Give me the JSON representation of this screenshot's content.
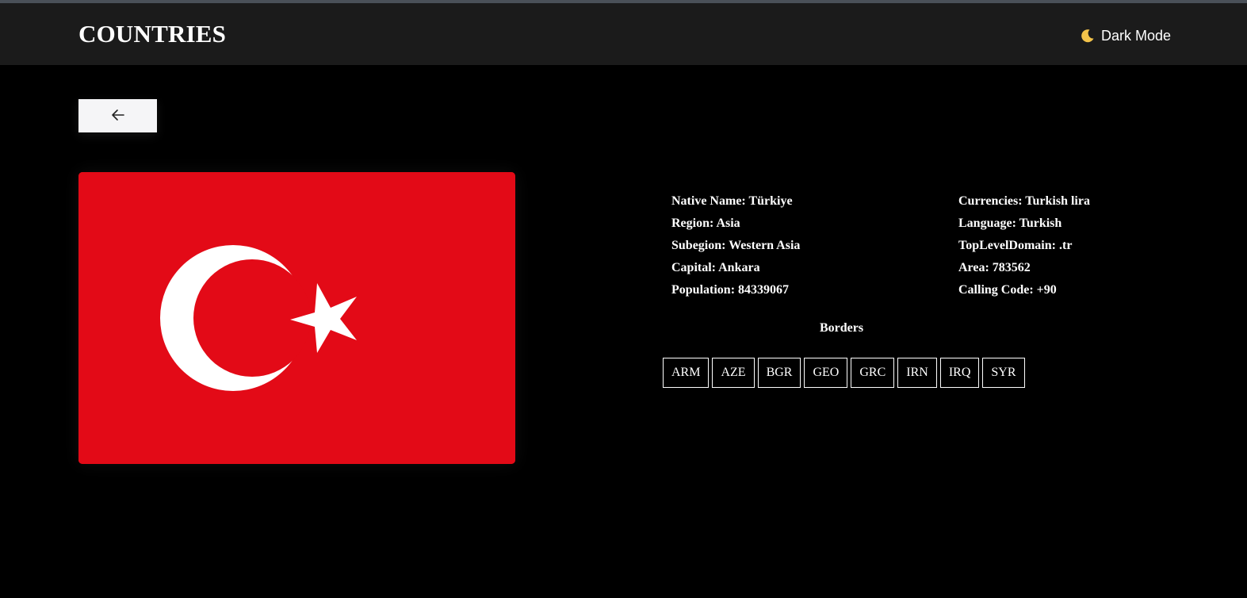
{
  "header": {
    "title": "COUNTRIES",
    "mode_label": "Dark Mode",
    "mode_icon": "moon-icon"
  },
  "back_button": {
    "icon": "arrow-left-icon"
  },
  "flag": {
    "country": "Türkiye",
    "background_color": "#e30a17",
    "emblem_color": "#ffffff"
  },
  "details": {
    "left": [
      {
        "label": "Native Name:",
        "value": "Türkiye"
      },
      {
        "label": "Region:",
        "value": "Asia"
      },
      {
        "label": "Subegion:",
        "value": "Western Asia"
      },
      {
        "label": "Capital:",
        "value": "Ankara"
      },
      {
        "label": "Population:",
        "value": "84339067"
      }
    ],
    "right": [
      {
        "label": "Currencies:",
        "value": "Turkish lira"
      },
      {
        "label": "Language:",
        "value": "Turkish"
      },
      {
        "label": "TopLevelDomain:",
        "value": ".tr"
      },
      {
        "label": "Area:",
        "value": "783562"
      },
      {
        "label": "Calling Code:",
        "value": "+90"
      }
    ]
  },
  "borders": {
    "title": "Borders",
    "items": [
      "ARM",
      "AZE",
      "BGR",
      "GEO",
      "GRC",
      "IRN",
      "IRQ",
      "SYR"
    ]
  },
  "colors": {
    "background": "#000000",
    "header": "#1b1b1b",
    "text": "#ffffff",
    "moon": "#f3c34a"
  }
}
